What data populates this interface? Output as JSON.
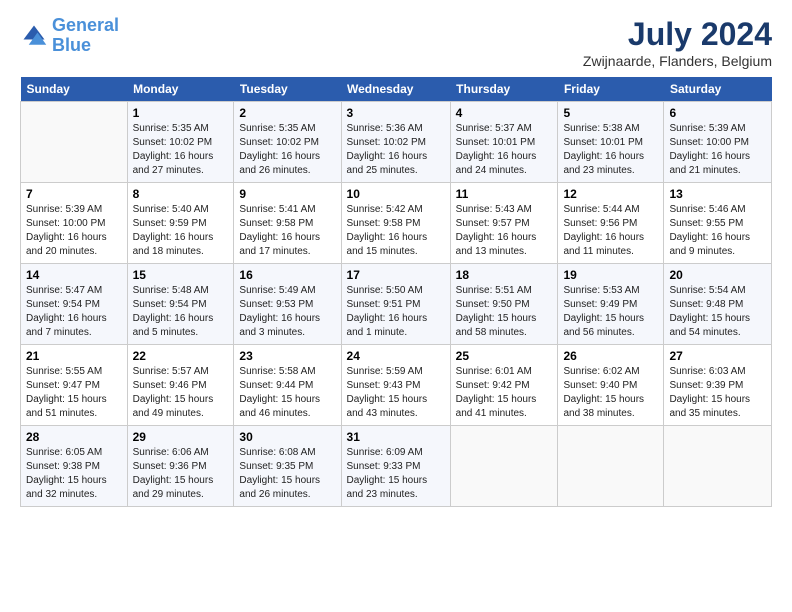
{
  "logo": {
    "line1": "General",
    "line2": "Blue"
  },
  "title": "July 2024",
  "location": "Zwijnaarde, Flanders, Belgium",
  "days_header": [
    "Sunday",
    "Monday",
    "Tuesday",
    "Wednesday",
    "Thursday",
    "Friday",
    "Saturday"
  ],
  "weeks": [
    [
      {
        "num": "",
        "text": ""
      },
      {
        "num": "1",
        "text": "Sunrise: 5:35 AM\nSunset: 10:02 PM\nDaylight: 16 hours\nand 27 minutes."
      },
      {
        "num": "2",
        "text": "Sunrise: 5:35 AM\nSunset: 10:02 PM\nDaylight: 16 hours\nand 26 minutes."
      },
      {
        "num": "3",
        "text": "Sunrise: 5:36 AM\nSunset: 10:02 PM\nDaylight: 16 hours\nand 25 minutes."
      },
      {
        "num": "4",
        "text": "Sunrise: 5:37 AM\nSunset: 10:01 PM\nDaylight: 16 hours\nand 24 minutes."
      },
      {
        "num": "5",
        "text": "Sunrise: 5:38 AM\nSunset: 10:01 PM\nDaylight: 16 hours\nand 23 minutes."
      },
      {
        "num": "6",
        "text": "Sunrise: 5:39 AM\nSunset: 10:00 PM\nDaylight: 16 hours\nand 21 minutes."
      }
    ],
    [
      {
        "num": "7",
        "text": "Sunrise: 5:39 AM\nSunset: 10:00 PM\nDaylight: 16 hours\nand 20 minutes."
      },
      {
        "num": "8",
        "text": "Sunrise: 5:40 AM\nSunset: 9:59 PM\nDaylight: 16 hours\nand 18 minutes."
      },
      {
        "num": "9",
        "text": "Sunrise: 5:41 AM\nSunset: 9:58 PM\nDaylight: 16 hours\nand 17 minutes."
      },
      {
        "num": "10",
        "text": "Sunrise: 5:42 AM\nSunset: 9:58 PM\nDaylight: 16 hours\nand 15 minutes."
      },
      {
        "num": "11",
        "text": "Sunrise: 5:43 AM\nSunset: 9:57 PM\nDaylight: 16 hours\nand 13 minutes."
      },
      {
        "num": "12",
        "text": "Sunrise: 5:44 AM\nSunset: 9:56 PM\nDaylight: 16 hours\nand 11 minutes."
      },
      {
        "num": "13",
        "text": "Sunrise: 5:46 AM\nSunset: 9:55 PM\nDaylight: 16 hours\nand 9 minutes."
      }
    ],
    [
      {
        "num": "14",
        "text": "Sunrise: 5:47 AM\nSunset: 9:54 PM\nDaylight: 16 hours\nand 7 minutes."
      },
      {
        "num": "15",
        "text": "Sunrise: 5:48 AM\nSunset: 9:54 PM\nDaylight: 16 hours\nand 5 minutes."
      },
      {
        "num": "16",
        "text": "Sunrise: 5:49 AM\nSunset: 9:53 PM\nDaylight: 16 hours\nand 3 minutes."
      },
      {
        "num": "17",
        "text": "Sunrise: 5:50 AM\nSunset: 9:51 PM\nDaylight: 16 hours\nand 1 minute."
      },
      {
        "num": "18",
        "text": "Sunrise: 5:51 AM\nSunset: 9:50 PM\nDaylight: 15 hours\nand 58 minutes."
      },
      {
        "num": "19",
        "text": "Sunrise: 5:53 AM\nSunset: 9:49 PM\nDaylight: 15 hours\nand 56 minutes."
      },
      {
        "num": "20",
        "text": "Sunrise: 5:54 AM\nSunset: 9:48 PM\nDaylight: 15 hours\nand 54 minutes."
      }
    ],
    [
      {
        "num": "21",
        "text": "Sunrise: 5:55 AM\nSunset: 9:47 PM\nDaylight: 15 hours\nand 51 minutes."
      },
      {
        "num": "22",
        "text": "Sunrise: 5:57 AM\nSunset: 9:46 PM\nDaylight: 15 hours\nand 49 minutes."
      },
      {
        "num": "23",
        "text": "Sunrise: 5:58 AM\nSunset: 9:44 PM\nDaylight: 15 hours\nand 46 minutes."
      },
      {
        "num": "24",
        "text": "Sunrise: 5:59 AM\nSunset: 9:43 PM\nDaylight: 15 hours\nand 43 minutes."
      },
      {
        "num": "25",
        "text": "Sunrise: 6:01 AM\nSunset: 9:42 PM\nDaylight: 15 hours\nand 41 minutes."
      },
      {
        "num": "26",
        "text": "Sunrise: 6:02 AM\nSunset: 9:40 PM\nDaylight: 15 hours\nand 38 minutes."
      },
      {
        "num": "27",
        "text": "Sunrise: 6:03 AM\nSunset: 9:39 PM\nDaylight: 15 hours\nand 35 minutes."
      }
    ],
    [
      {
        "num": "28",
        "text": "Sunrise: 6:05 AM\nSunset: 9:38 PM\nDaylight: 15 hours\nand 32 minutes."
      },
      {
        "num": "29",
        "text": "Sunrise: 6:06 AM\nSunset: 9:36 PM\nDaylight: 15 hours\nand 29 minutes."
      },
      {
        "num": "30",
        "text": "Sunrise: 6:08 AM\nSunset: 9:35 PM\nDaylight: 15 hours\nand 26 minutes."
      },
      {
        "num": "31",
        "text": "Sunrise: 6:09 AM\nSunset: 9:33 PM\nDaylight: 15 hours\nand 23 minutes."
      },
      {
        "num": "",
        "text": ""
      },
      {
        "num": "",
        "text": ""
      },
      {
        "num": "",
        "text": ""
      }
    ]
  ]
}
